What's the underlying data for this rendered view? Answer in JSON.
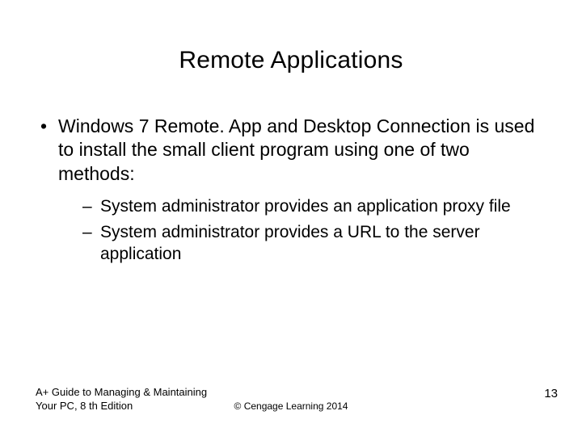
{
  "title": "Remote Applications",
  "bullets": {
    "main": "Windows 7 Remote. App and Desktop Connection is used to install the small client program using one of two methods:",
    "subs": [
      "System administrator provides an application proxy file",
      "System administrator provides a URL to the server application"
    ]
  },
  "footer": {
    "left_line1": "A+ Guide to Managing & Maintaining",
    "left_line2": "Your PC, 8 th Edition",
    "center": "©  Cengage Learning 2014",
    "page": "13"
  }
}
